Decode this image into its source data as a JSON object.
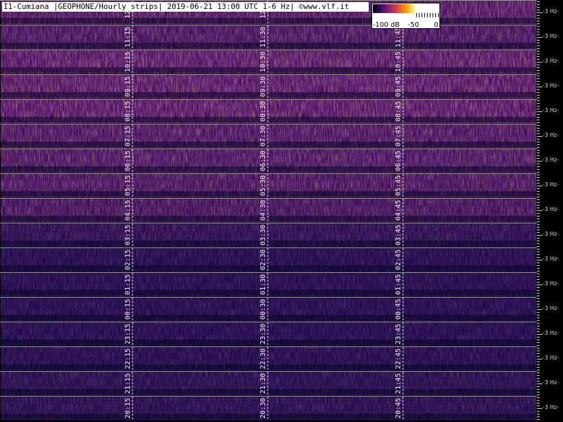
{
  "header": {
    "title": "I1-Cumiana |GEOPHONE/Hourly strips| 2019-06-21 13:00 UTC 1-6 Hz| ©www.vlf.it"
  },
  "colorbar": {
    "min_label": "-100 dB",
    "mid_label": "-50",
    "max_label": "0"
  },
  "chart_data": {
    "type": "heatmap",
    "title": "I1-Cumiana |GEOPHONE/Hourly strips| 2019-06-21 13:00 UTC 1-6 Hz| ©www.vlf.it",
    "frequency_label": "3 Hz",
    "strips": [
      {
        "ticks": [
          "12:",
          "12:"
        ],
        "intensity": 0.55
      },
      {
        "ticks": [
          "11:15",
          "11:30",
          "11:45"
        ],
        "intensity": 0.45
      },
      {
        "ticks": [
          "10:15",
          "10:30",
          "10:45"
        ],
        "intensity": 0.6
      },
      {
        "ticks": [
          "09:15",
          "09:30",
          "09:45"
        ],
        "intensity": 0.6
      },
      {
        "ticks": [
          "08:15",
          "08:30",
          "08:45"
        ],
        "intensity": 0.6
      },
      {
        "ticks": [
          "07:15",
          "07:30",
          "07:45"
        ],
        "intensity": 0.5
      },
      {
        "ticks": [
          "06:15",
          "06:30",
          "06:45"
        ],
        "intensity": 0.5
      },
      {
        "ticks": [
          "05:15",
          "05:30",
          "05:45"
        ],
        "intensity": 0.45
      },
      {
        "ticks": [
          "04:15",
          "04:30",
          "04:45"
        ],
        "intensity": 0.4
      },
      {
        "ticks": [
          "03:15",
          "03:30",
          "03:45"
        ],
        "intensity": 0.2
      },
      {
        "ticks": [
          "02:15",
          "02:30",
          "02:45"
        ],
        "intensity": 0.12
      },
      {
        "ticks": [
          "01:15",
          "01:30",
          "01:45"
        ],
        "intensity": 0.12
      },
      {
        "ticks": [
          "00:15",
          "00:30",
          "00:45"
        ],
        "intensity": 0.12
      },
      {
        "ticks": [
          "23:15",
          "23:30",
          "23:45"
        ],
        "intensity": 0.12
      },
      {
        "ticks": [
          "22:15",
          "22:30",
          "22:45"
        ],
        "intensity": 0.12
      },
      {
        "ticks": [
          "21:15",
          "21:30",
          "21:45"
        ],
        "intensity": 0.15
      },
      {
        "ticks": [
          "20:15",
          "20:30",
          "20:45"
        ],
        "intensity": 0.15
      }
    ]
  }
}
